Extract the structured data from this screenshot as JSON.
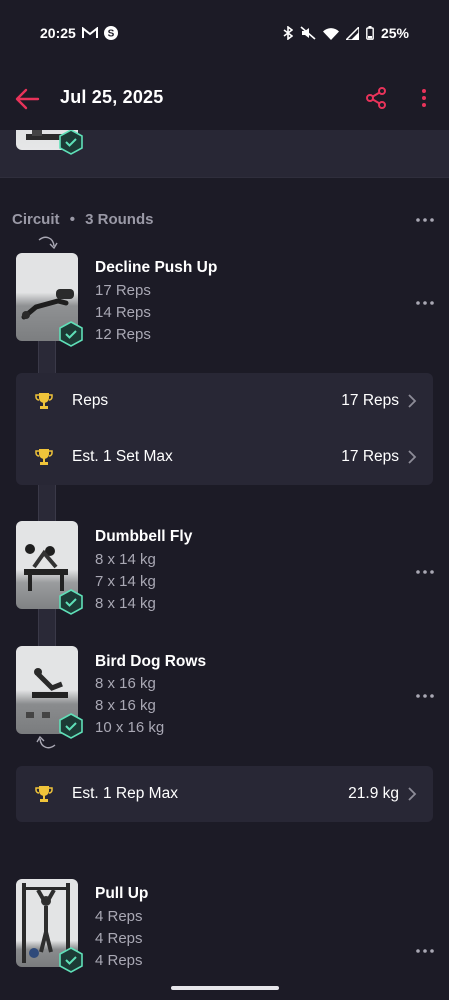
{
  "status_bar": {
    "time": "20:25",
    "battery": "25%",
    "icons": [
      "gmail-icon",
      "s-app-icon",
      "bluetooth-icon",
      "mute-icon",
      "wifi-icon",
      "signal-icon",
      "battery-icon"
    ]
  },
  "header": {
    "title": "Jul 25, 2025",
    "accent_color": "#e8335a"
  },
  "circuit": {
    "label": "Circuit",
    "separator": "•",
    "rounds": "3 Rounds"
  },
  "exercises": [
    {
      "name": "Decline Push Up",
      "sets": [
        "17 Reps",
        "14 Reps",
        "12 Reps"
      ]
    },
    {
      "name": "Dumbbell Fly",
      "sets": [
        "8 x 14 kg",
        "7 x 14 kg",
        "8 x 14 kg"
      ]
    },
    {
      "name": "Bird Dog Rows",
      "sets": [
        "8 x 16 kg",
        "8 x 16 kg",
        "10 x 16 kg"
      ]
    },
    {
      "name": "Pull Up",
      "sets": [
        "4 Reps",
        "4 Reps",
        "4 Reps"
      ]
    }
  ],
  "records_1": [
    {
      "label": "Reps",
      "value": "17 Reps"
    },
    {
      "label": "Est. 1 Set Max",
      "value": "17 Reps"
    }
  ],
  "records_2": [
    {
      "label": "Est. 1 Rep Max",
      "value": "21.9 kg"
    }
  ],
  "colors": {
    "background": "#1c1b26",
    "card": "#282735",
    "check": "#5fe0b8",
    "trophy": "#f0c43a",
    "muted_text": "#a9a8b4"
  }
}
